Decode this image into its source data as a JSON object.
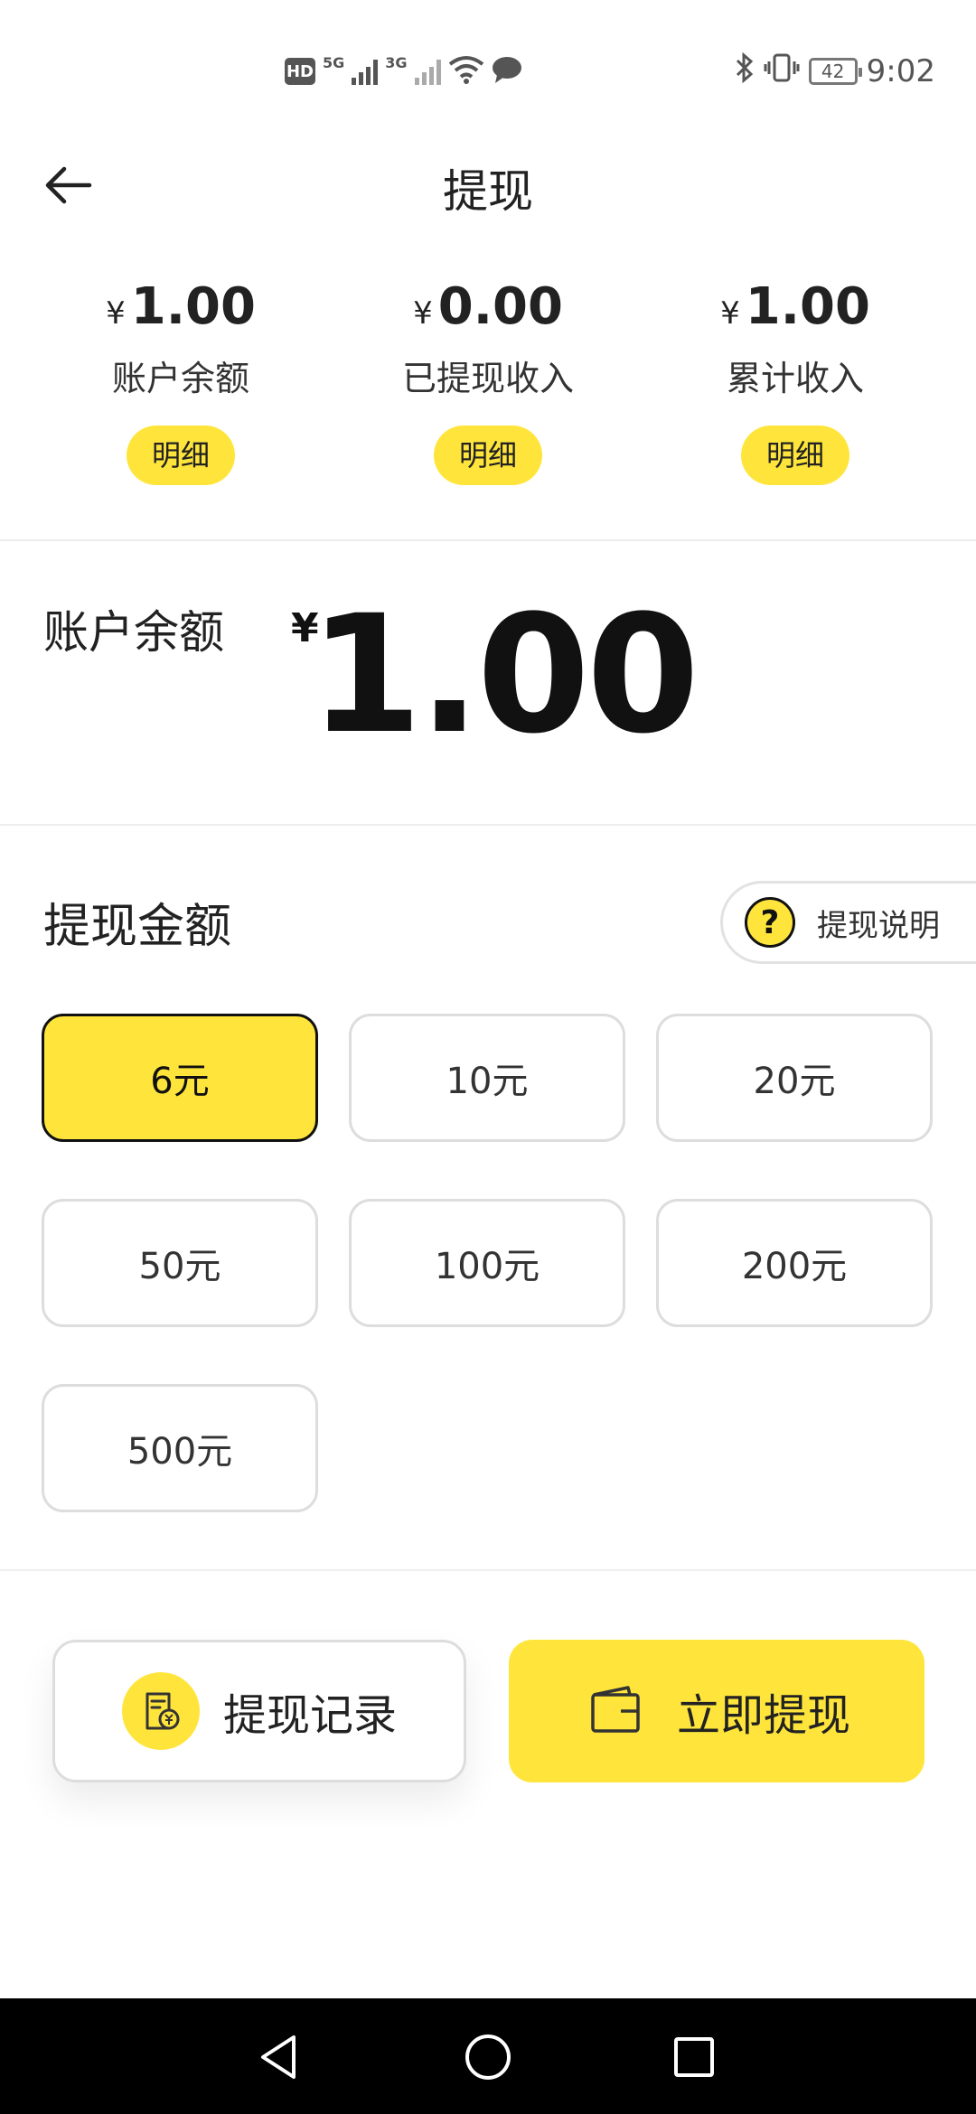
{
  "status_bar": {
    "hd_label": "HD",
    "signal1_label": "5G",
    "signal2_label": "3G",
    "battery": "42",
    "time": "9:02"
  },
  "header": {
    "title": "提现"
  },
  "stats": [
    {
      "currency": "¥",
      "amount": "1.00",
      "label": "账户余额",
      "detail_label": "明细"
    },
    {
      "currency": "¥",
      "amount": "0.00",
      "label": "已提现收入",
      "detail_label": "明细"
    },
    {
      "currency": "¥",
      "amount": "1.00",
      "label": "累计收入",
      "detail_label": "明细"
    }
  ],
  "balance": {
    "label": "账户余额",
    "currency": "¥",
    "value": "1.00"
  },
  "withdraw_amount": {
    "title": "提现金额",
    "explain_label": "提现说明",
    "options": [
      "6元",
      "10元",
      "20元",
      "50元",
      "100元",
      "200元",
      "500元"
    ],
    "selected": "6元"
  },
  "actions": {
    "records_label": "提现记录",
    "withdraw_label": "立即提现"
  },
  "colors": {
    "accent": "#ffe53b",
    "text": "#222222",
    "border": "#dddddd"
  },
  "icons": {
    "back": "arrow-left-icon",
    "question": "question-icon",
    "records": "receipt-yuan-icon",
    "wallet": "wallet-icon"
  }
}
